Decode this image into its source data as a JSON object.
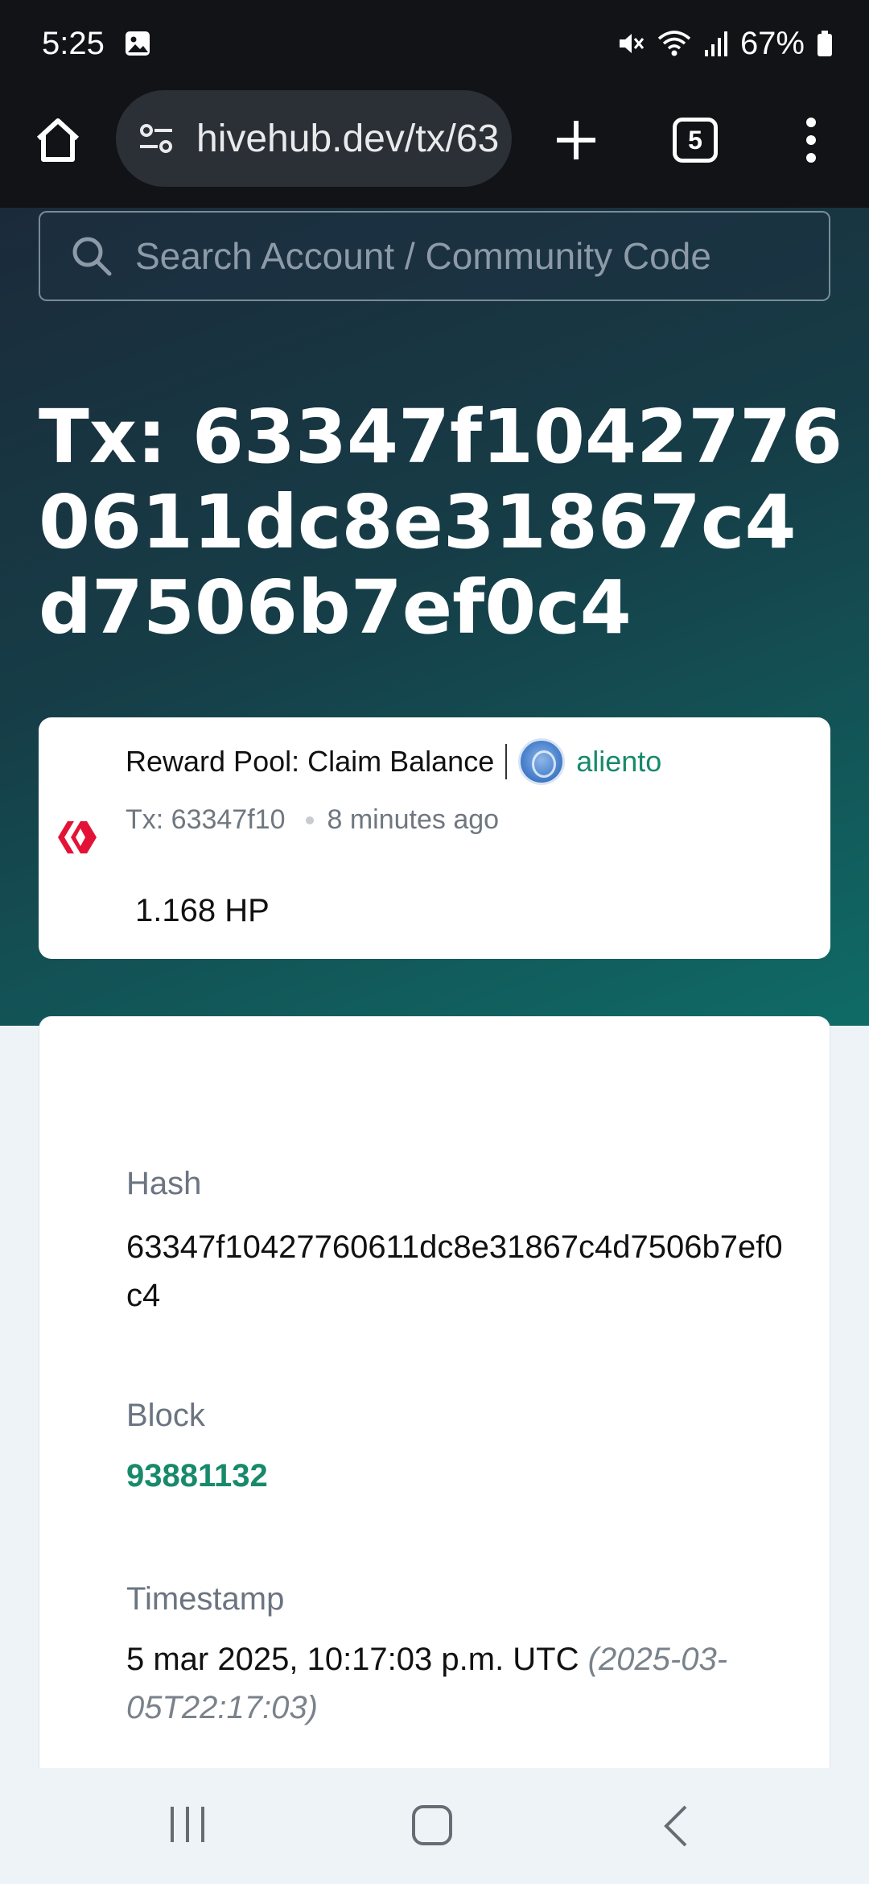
{
  "status_bar": {
    "time": "5:25",
    "battery": "67%",
    "icons": [
      "image-icon",
      "mute-icon",
      "wifi-icon",
      "signal-icon",
      "battery-icon"
    ]
  },
  "browser": {
    "url": "hivehub.dev/tx/63",
    "tab_count": "5"
  },
  "search": {
    "placeholder": "Search Account / Community Code"
  },
  "page": {
    "title": "Tx: 63347f10427760611dc8e31867c4d7506b7ef0c4"
  },
  "operation": {
    "type": "Reward Pool: Claim Balance",
    "user": "aliento",
    "tx_short": "Tx: 63347f10",
    "time_ago": "8 minutes ago",
    "amount": "1.168 HP"
  },
  "details": {
    "hash_label": "Hash",
    "hash_value": "63347f10427760611dc8e31867c4d7506b7ef0c4",
    "block_label": "Block",
    "block_value": "93881132",
    "timestamp_label": "Timestamp",
    "timestamp_value": "5 mar 2025, 10:17:03 p.m. UTC",
    "timestamp_iso": "(2025-03-05T22:17:03)"
  },
  "colors": {
    "accent": "#178a6b",
    "hive_red": "#e31337"
  }
}
